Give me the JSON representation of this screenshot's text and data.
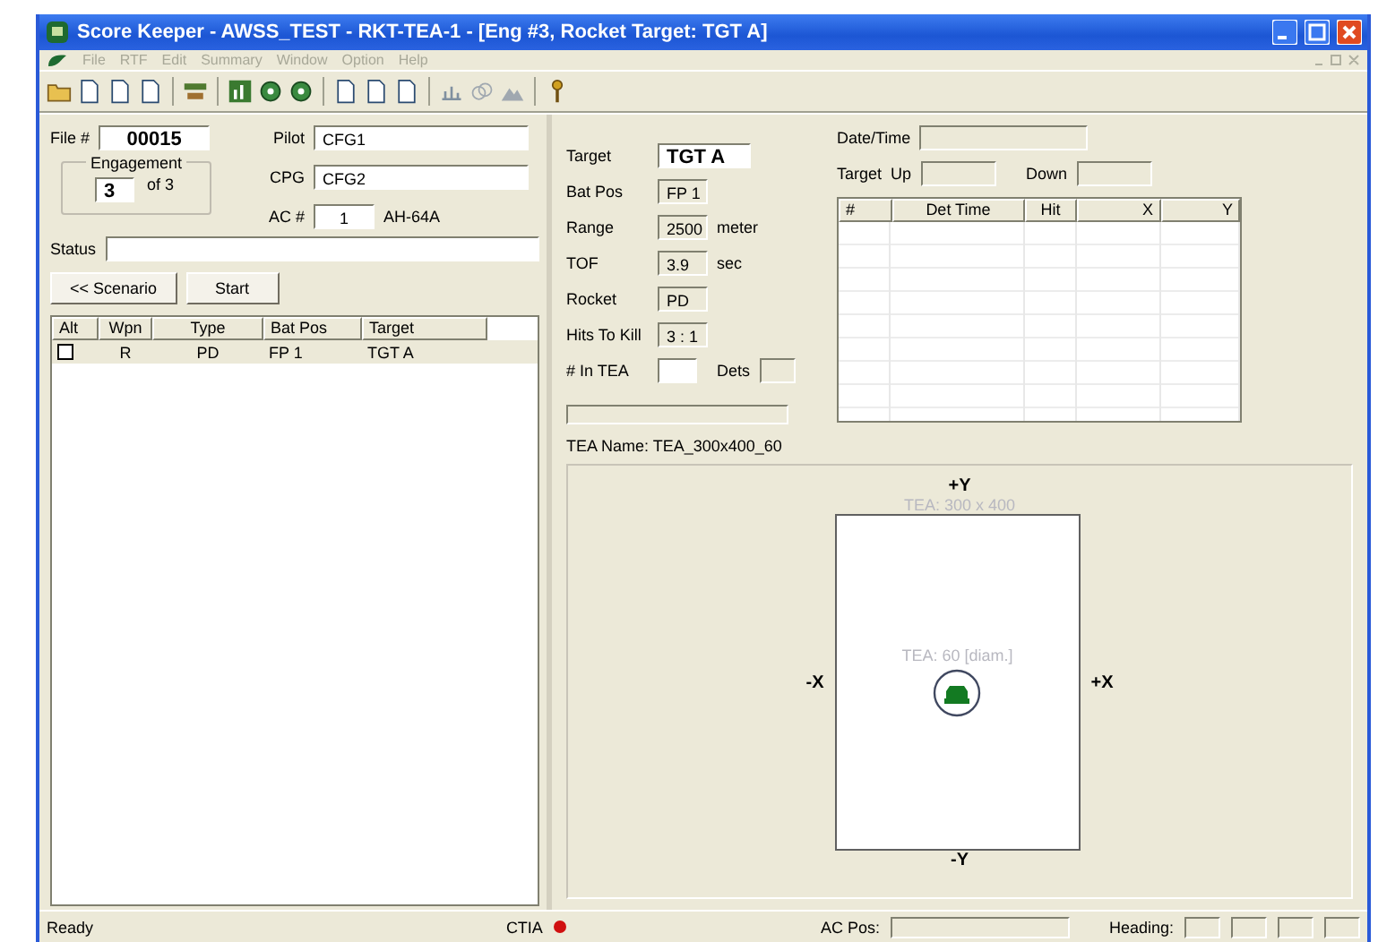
{
  "window": {
    "title": "Score Keeper - AWSS_TEST - RKT-TEA-1 - [Eng #3, Rocket Target: TGT A]"
  },
  "menu": [
    "File",
    "RTF",
    "Edit",
    "Summary",
    "Window",
    "Option",
    "Help"
  ],
  "left": {
    "file": {
      "label": "File #",
      "value": "00015"
    },
    "engagement": {
      "label": "Engagement",
      "current": "3",
      "of": "of 3"
    },
    "pilot": {
      "label": "Pilot",
      "value": "CFG1"
    },
    "cpg": {
      "label": "CPG",
      "value": "CFG2"
    },
    "ac": {
      "label": "AC #",
      "value": "1",
      "type": "AH-64A"
    },
    "status": {
      "label": "Status"
    },
    "buttons": [
      "<< Scenario",
      "Start"
    ],
    "table": {
      "columns": [
        "Alt",
        "Wpn",
        "Type",
        "Bat Pos",
        "Target"
      ],
      "rows": [
        {
          "checked": false,
          "selected": true,
          "cells": [
            "",
            "R",
            "PD",
            "FP 1",
            "TGT A"
          ]
        }
      ]
    }
  },
  "right": {
    "fields": [
      {
        "label": "Target",
        "value": "TGT A",
        "kind": "edit"
      },
      {
        "label": "Bat Pos",
        "value": "FP 1",
        "kind": "readonly"
      },
      {
        "label": "Range",
        "value": "2500",
        "unit": "meter",
        "kind": "readonly"
      },
      {
        "label": "TOF",
        "value": "3.9",
        "unit": "sec",
        "kind": "readonly"
      },
      {
        "label": "Rocket",
        "value": "PD",
        "kind": "readonly"
      },
      {
        "label": "Hits To Kill",
        "value": "3 : 1",
        "kind": "readonly"
      }
    ],
    "in_tea": {
      "label": "# In TEA",
      "dets_label": "Dets"
    },
    "date_time_label": "Date/Time",
    "target_label": "Target",
    "up_label": "Up",
    "down_label": "Down",
    "det_table": {
      "columns": [
        "#",
        "Det Time",
        "Hit",
        "X",
        "Y"
      ]
    },
    "tea_name": "TEA Name: TEA_300x400_60",
    "diagram": {
      "plus_y": "+Y",
      "minus_y": "-Y",
      "minus_x": "-X",
      "plus_x": "+X",
      "area_label": "TEA: 300 x 400",
      "circle_label": "TEA: 60 [diam.]"
    }
  },
  "status_bar": {
    "message": "Ready",
    "ctia": "CTIA",
    "ac_pos_label": "AC Pos:",
    "heading_label": "Heading:"
  }
}
